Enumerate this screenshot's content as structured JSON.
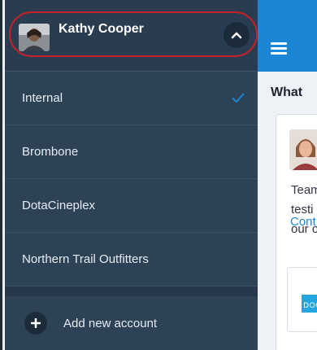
{
  "drawer": {
    "user_name": "Kathy Cooper",
    "accounts": [
      {
        "label": "Internal",
        "selected": true
      },
      {
        "label": "Brombone",
        "selected": false
      },
      {
        "label": "DotaCineplex",
        "selected": false
      },
      {
        "label": "Northern Trail Outfitters",
        "selected": false
      }
    ],
    "add_account_label": "Add new account",
    "icons": {
      "collapse": "chevron-up-icon",
      "selected": "check-icon",
      "add": "plus-icon"
    }
  },
  "main": {
    "menu_icon": "hamburger-menu-icon",
    "feed_title": "What",
    "post_text_lines": [
      "Team",
      "testi",
      "our c"
    ],
    "link_text": "Cont",
    "attachment_logo": "DOC"
  },
  "colors": {
    "drawer_bg": "#2e4256",
    "header_accent": "#1b86d6",
    "highlight": "#c8202a",
    "check": "#1b86d6"
  }
}
